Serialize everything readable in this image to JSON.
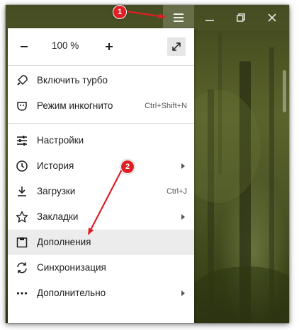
{
  "window": {
    "controls": {
      "menu_icon": "hamburger-icon",
      "minimize_icon": "minimize-icon",
      "restore_icon": "restore-icon",
      "close_icon": "close-icon"
    }
  },
  "zoom": {
    "minus": "−",
    "value": "100 %",
    "plus": "+",
    "fullscreen_icon": "fullscreen-icon"
  },
  "menu": {
    "group_a": [
      {
        "id": "turbo",
        "label": "Включить турбо",
        "icon": "rocket-icon",
        "shortcut": "",
        "submenu": false
      },
      {
        "id": "incognito",
        "label": "Режим инкогнито",
        "icon": "incognito-mask-icon",
        "shortcut": "Ctrl+Shift+N",
        "submenu": false
      }
    ],
    "group_b": [
      {
        "id": "settings",
        "label": "Настройки",
        "icon": "sliders-icon",
        "shortcut": "",
        "submenu": false
      },
      {
        "id": "history",
        "label": "История",
        "icon": "clock-icon",
        "shortcut": "",
        "submenu": true
      },
      {
        "id": "downloads",
        "label": "Загрузки",
        "icon": "download-icon",
        "shortcut": "Ctrl+J",
        "submenu": false
      },
      {
        "id": "bookmarks",
        "label": "Закладки",
        "icon": "star-icon",
        "shortcut": "",
        "submenu": true
      },
      {
        "id": "addons",
        "label": "Дополнения",
        "icon": "addons-icon",
        "shortcut": "",
        "submenu": false,
        "highlighted": true
      },
      {
        "id": "sync",
        "label": "Синхронизация",
        "icon": "sync-icon",
        "shortcut": "",
        "submenu": false
      },
      {
        "id": "more",
        "label": "Дополнительно",
        "icon": "more-dots-icon",
        "shortcut": "",
        "submenu": true
      }
    ]
  },
  "annotations": {
    "marker_1": "1",
    "marker_2": "2",
    "color": "#e01f25"
  },
  "colors": {
    "titlebar": "#4a5125",
    "menu_bg": "#ffffff",
    "highlight": "#ececec",
    "marker": "#e01f25"
  }
}
